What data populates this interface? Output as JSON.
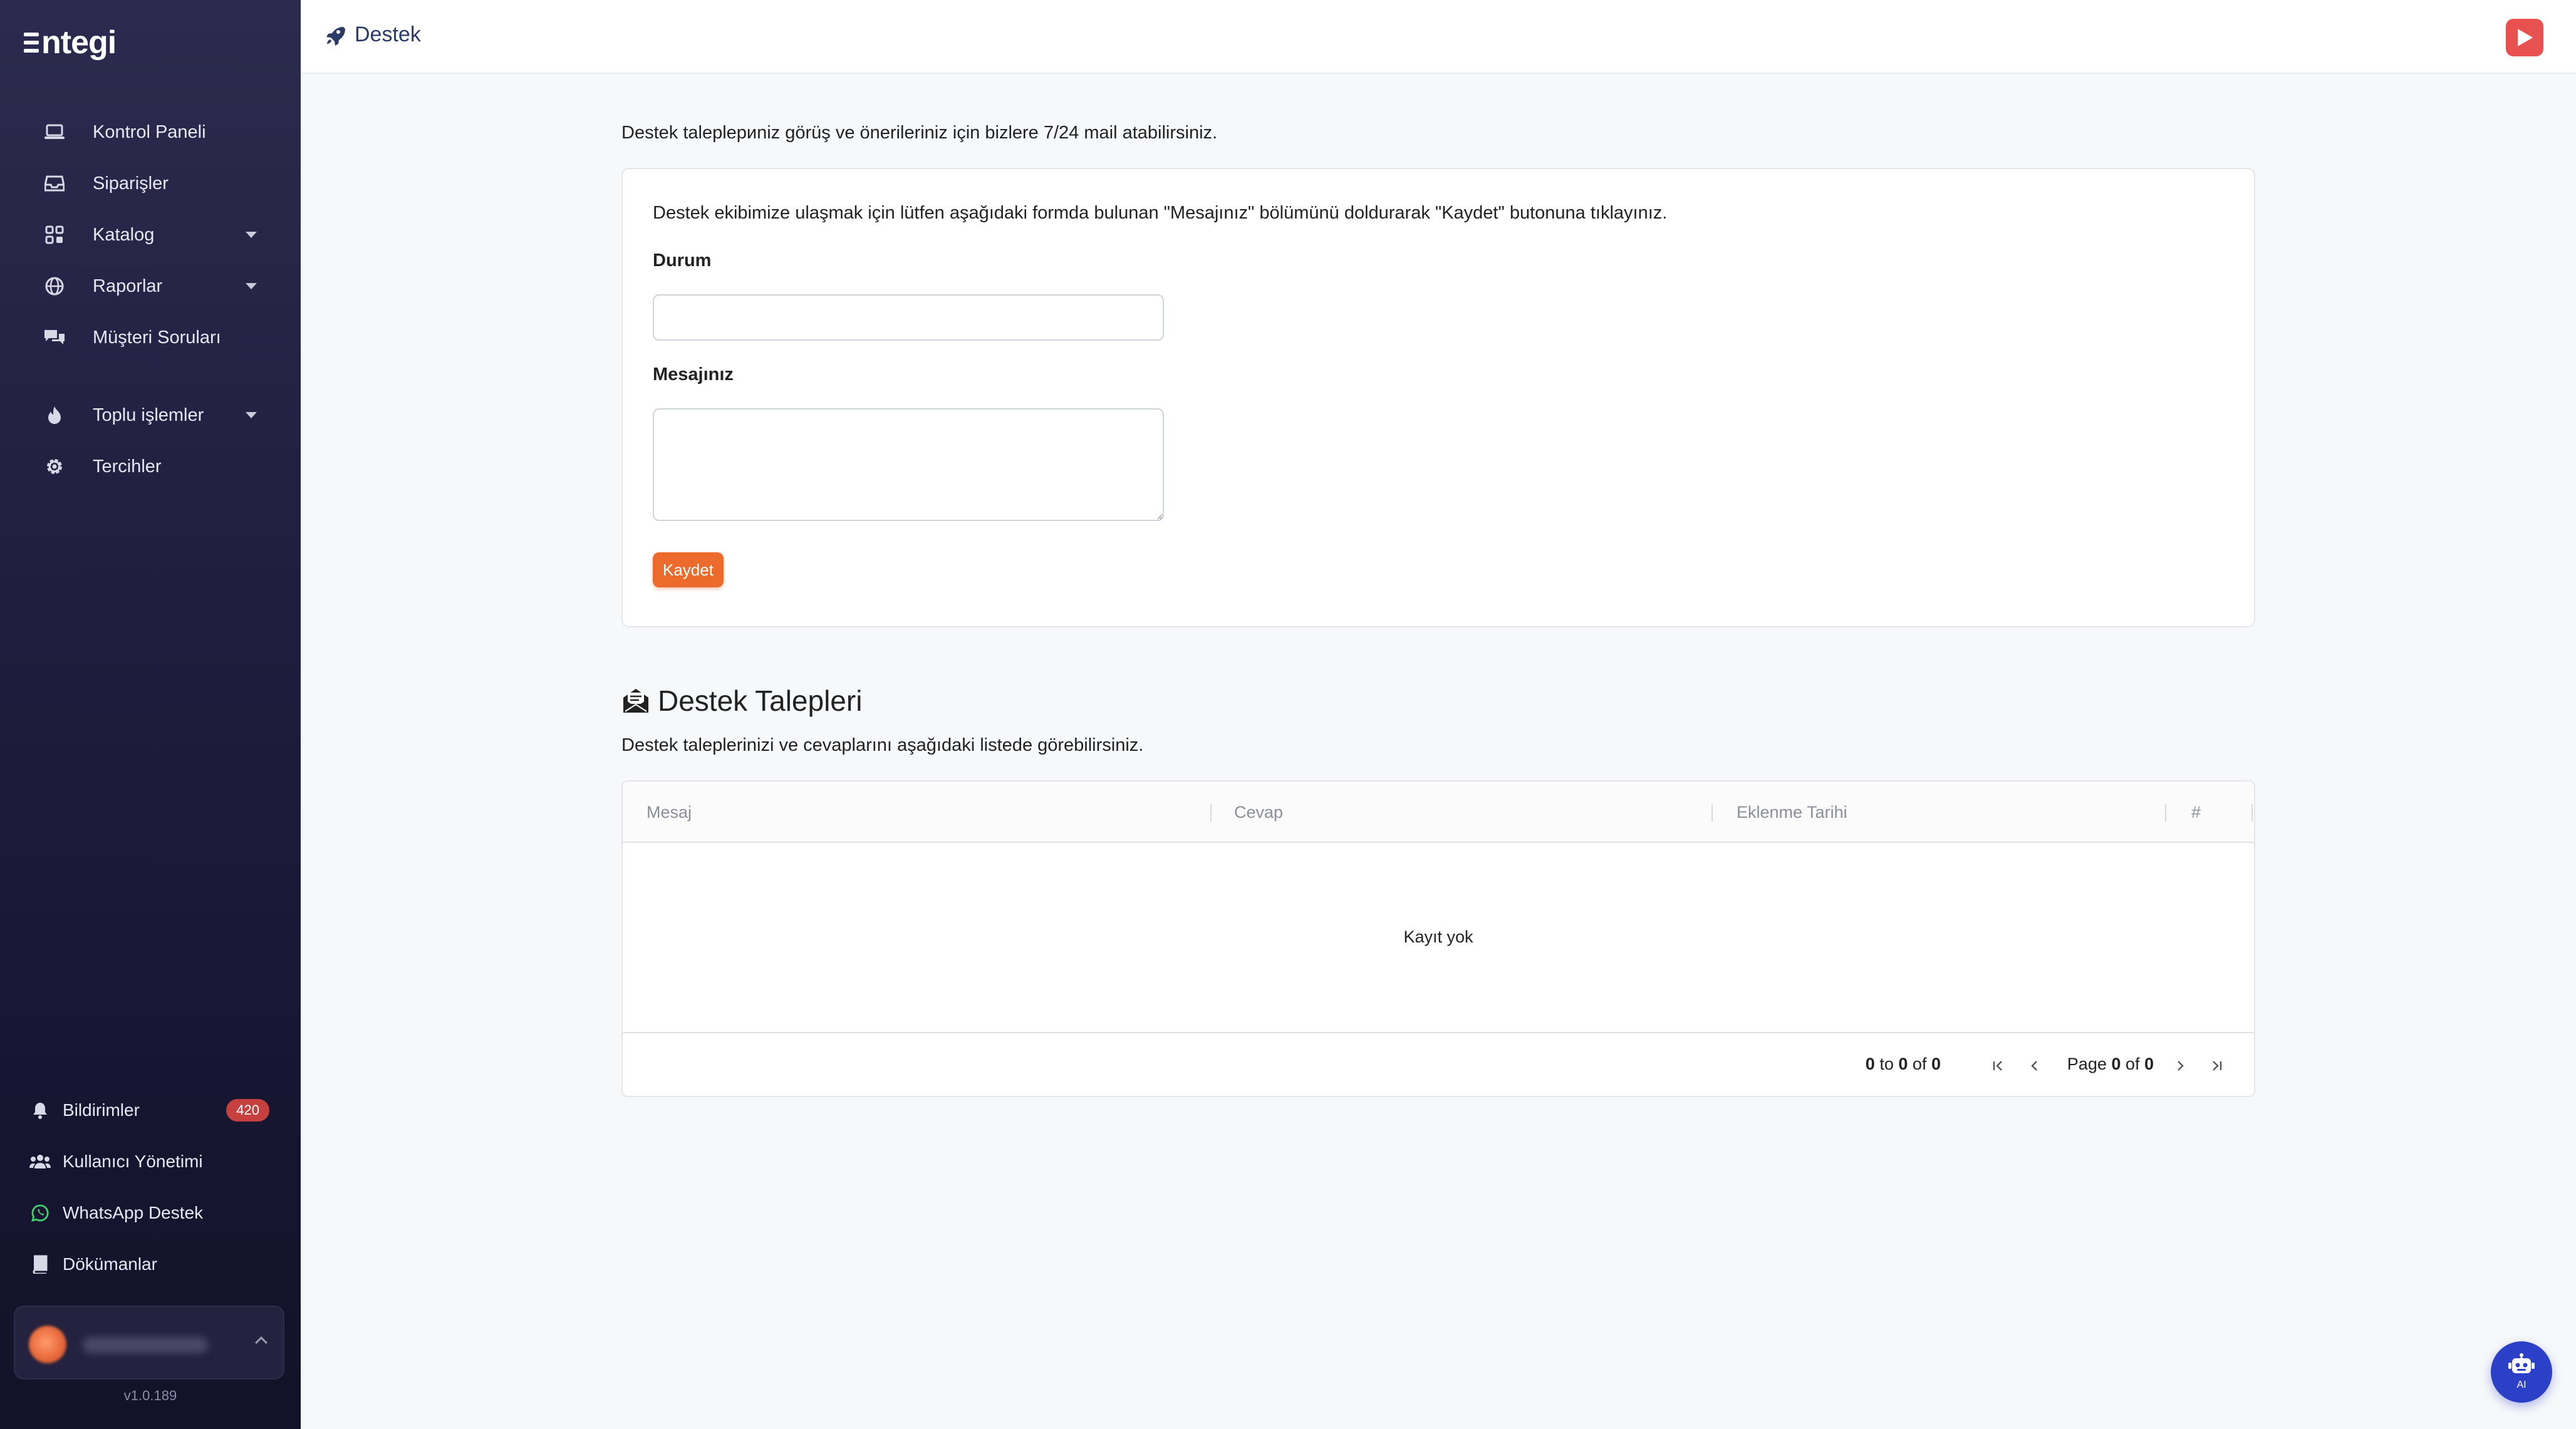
{
  "sidebar": {
    "logo": "ntegi",
    "items": [
      {
        "label": "Kontrol Paneli",
        "icon": "laptop-icon"
      },
      {
        "label": "Siparişler",
        "icon": "inbox-icon"
      },
      {
        "label": "Katalog",
        "icon": "grid-icon",
        "expandable": true
      },
      {
        "label": "Raporlar",
        "icon": "globe-icon",
        "expandable": true
      },
      {
        "label": "Müşteri Soruları",
        "icon": "chat-icon"
      },
      {
        "label": "Toplu işlemler",
        "icon": "fire-icon",
        "expandable": true
      },
      {
        "label": "Tercihler",
        "icon": "gear-icon"
      }
    ],
    "bottom": [
      {
        "label": "Bildirimler",
        "icon": "bell-icon",
        "badge": "420"
      },
      {
        "label": "Kullanıcı Yönetimi",
        "icon": "users-icon"
      },
      {
        "label": "WhatsApp Destek",
        "icon": "whatsapp-icon"
      },
      {
        "label": "Dökümanlar",
        "icon": "book-icon"
      }
    ],
    "version": "v1.0.189"
  },
  "header": {
    "title": "Destek",
    "title_icon": "rocket-icon",
    "action_icon": "play-icon"
  },
  "main": {
    "intro": "Destek taleplериniz görüş ve önerileriniz için bizlere 7/24 mail atabilirsiniz.",
    "form": {
      "hint": "Destek ekibimize ulaşmak için lütfen aşağıdaki formda bulunan \"Mesajınız\" bölümünü doldurarak \"Kaydet\" butonuna tıklayınız.",
      "status_label": "Durum",
      "status_value": "",
      "message_label": "Mesajınız",
      "message_value": "",
      "save_label": "Kaydet"
    },
    "requests": {
      "title": "Destek Talepleri",
      "subtitle": "Destek taleplerinizi ve cevaplarını aşağıdaki listede görebilirsiniz.",
      "columns": [
        "Mesaj",
        "Cevap",
        "Eklenme Tarihi",
        "#"
      ],
      "rows": [],
      "empty_text": "Kayıt yok",
      "paging": {
        "from": "0",
        "to_word": "to",
        "to": "0",
        "of_word": "of",
        "total": "0",
        "page_word": "Page",
        "page": "0",
        "pages": "0"
      }
    }
  },
  "assistant": {
    "label": "AI"
  },
  "colors": {
    "accent": "#ec6a2c",
    "sidebar_bg": "#1f1d3d",
    "badge": "#c6403f",
    "assistant": "#2c3fc7",
    "header_title": "#2b3a67"
  }
}
